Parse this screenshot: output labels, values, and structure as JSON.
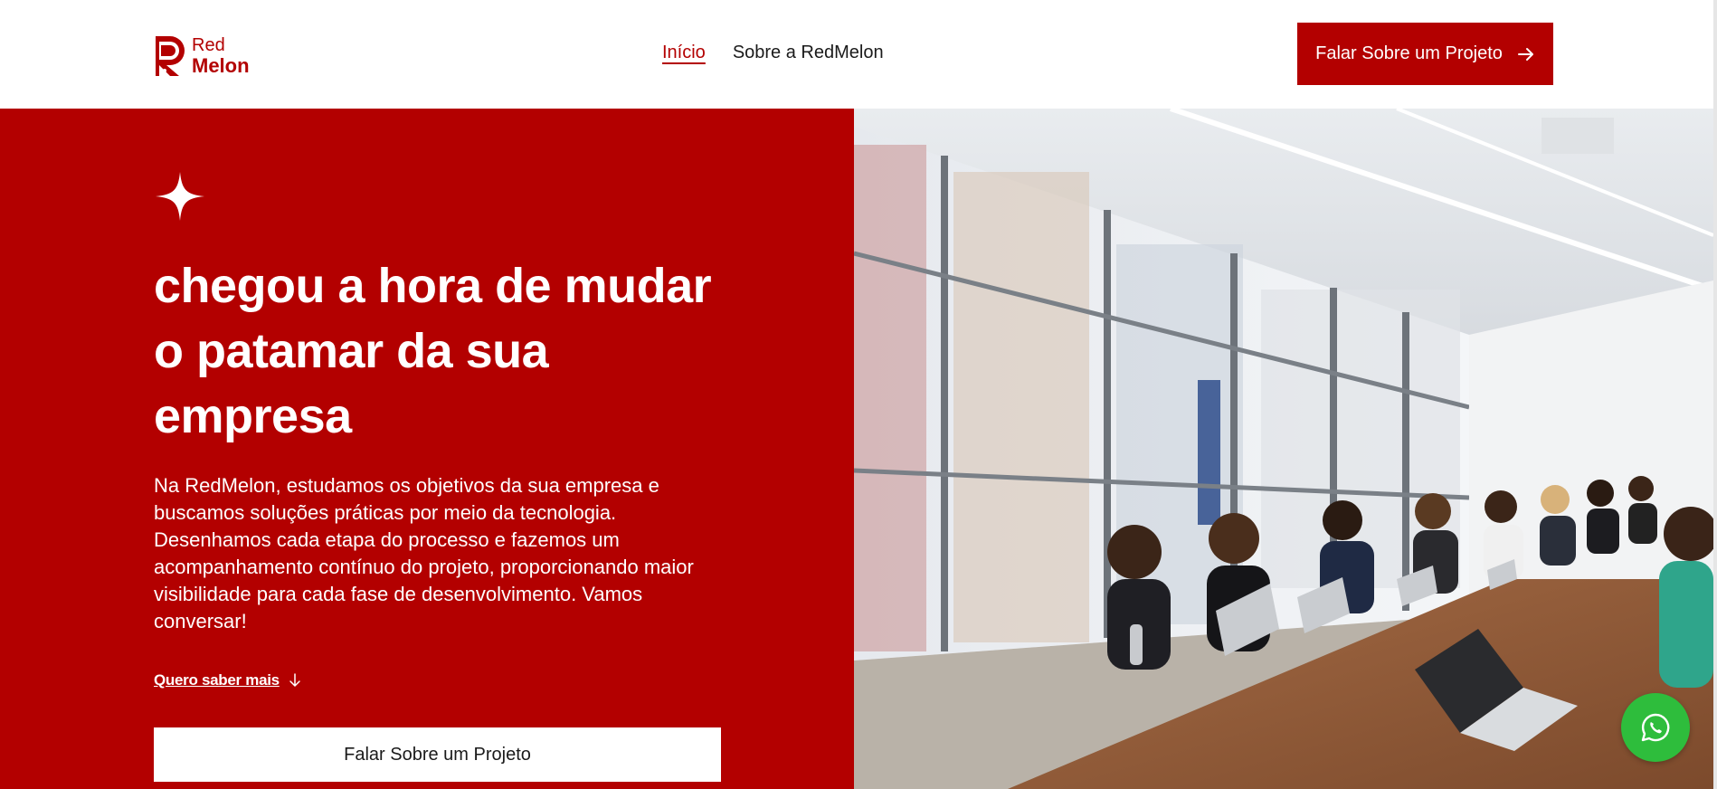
{
  "brand": {
    "line1": "Red",
    "line2": "Melon",
    "color": "#b30000"
  },
  "nav": {
    "items": [
      {
        "label": "Início",
        "active": true
      },
      {
        "label": "Sobre a RedMelon",
        "active": false
      }
    ]
  },
  "header": {
    "cta_label": "Falar Sobre um Projeto"
  },
  "hero": {
    "title": "chegou a hora de mudar o patamar da sua empresa",
    "description": "Na RedMelon, estudamos os objetivos da sua empresa e buscamos soluções práticas por meio da tecnologia. Desenhamos cada etapa do processo e fazemos um acompanhamento contínuo do projeto, proporcionando maior visibilidade para cada fase de desenvolvimento. Vamos conversar!",
    "more_link": "Quero saber mais",
    "cta_label": "Falar Sobre um Projeto",
    "background": "#b30000"
  },
  "icons": {
    "logo": "redmelon-logo-icon",
    "header_cta": "arrow-right-icon",
    "sparkle": "sparkle-icon",
    "more": "arrow-down-icon",
    "whatsapp": "whatsapp-icon"
  },
  "whatsapp": {
    "color": "#2ebd3c"
  }
}
